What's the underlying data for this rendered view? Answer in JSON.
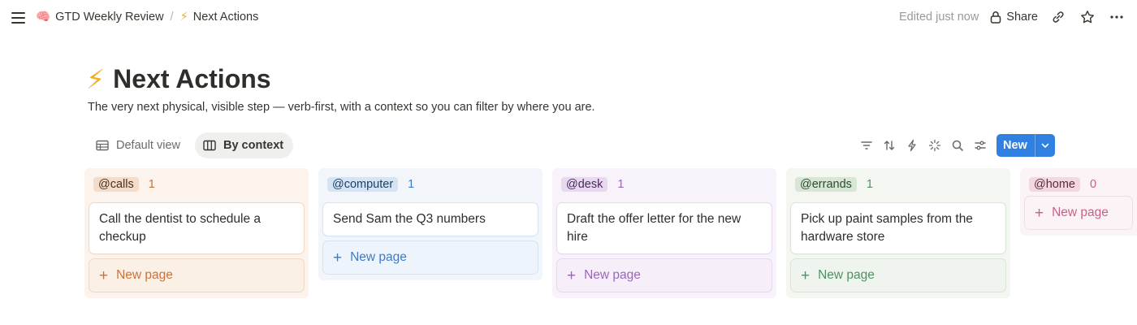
{
  "breadcrumb": {
    "parent": {
      "emoji": "🧠",
      "label": "GTD Weekly Review"
    },
    "separator": "/",
    "current": {
      "emoji": "⚡",
      "label": "Next Actions"
    }
  },
  "topbar": {
    "edited": "Edited just now",
    "share_label": "Share"
  },
  "page": {
    "emoji": "⚡",
    "title": "Next Actions",
    "description": "The very next physical, visible step — verb-first, with a context so you can filter by where you are."
  },
  "views": [
    {
      "label": "Default view",
      "icon": "table-icon",
      "active": false
    },
    {
      "label": "By context",
      "icon": "board-icon",
      "active": true
    }
  ],
  "toolbar": {
    "icons": [
      "filter-icon",
      "sort-icon",
      "automation-icon",
      "ai-sparkle-icon",
      "search-icon",
      "settings-sliders-icon"
    ],
    "new_label": "New"
  },
  "board": {
    "new_page_label": "New page",
    "columns": [
      {
        "tag": "@calls",
        "count": "1",
        "cards": [
          "Call the dentist to schedule a checkup"
        ],
        "colors": {
          "bg": "#fbf3ec",
          "pill": "#f3dcc9",
          "pill_text": "#4a2f1c",
          "accent": "#c8733a",
          "newbg": "#faf0e6",
          "border": "#efd9c6"
        }
      },
      {
        "tag": "@computer",
        "count": "1",
        "cards": [
          "Send Sam the Q3 numbers"
        ],
        "colors": {
          "bg": "#f2f6fb",
          "pill": "#d5e4f5",
          "pill_text": "#1f3f66",
          "accent": "#3f7ac2",
          "newbg": "#eef4fb",
          "border": "#d6e3f2"
        }
      },
      {
        "tag": "@desk",
        "count": "1",
        "cards": [
          "Draft the offer letter for the new hire"
        ],
        "colors": {
          "bg": "#f8f3fa",
          "pill": "#e8d9f0",
          "pill_text": "#4a2a5c",
          "accent": "#9a66b8",
          "newbg": "#f6eff9",
          "border": "#e6d8ef"
        }
      },
      {
        "tag": "@errands",
        "count": "1",
        "cards": [
          "Pick up paint samples from the hardware store"
        ],
        "colors": {
          "bg": "#f3f6f1",
          "pill": "#d8e6d6",
          "pill_text": "#2c4a2c",
          "accent": "#4f9160",
          "newbg": "#eff5ee",
          "border": "#d8e6d6"
        }
      },
      {
        "tag": "@home",
        "count": "0",
        "cards": [],
        "colors": {
          "bg": "#fbf3f5",
          "pill": "#f2d9e1",
          "pill_text": "#5c2a3a",
          "accent": "#c8608a",
          "newbg": "#fbf3f5",
          "border": "#f0dde4"
        }
      }
    ]
  }
}
